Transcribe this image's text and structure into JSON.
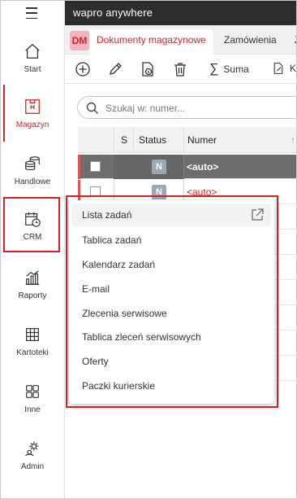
{
  "app": {
    "brand": "wapro anywhere"
  },
  "sidebar": {
    "items": [
      {
        "label": "Start",
        "icon": "home-icon"
      },
      {
        "label": "Magazyn",
        "icon": "warehouse-icon"
      },
      {
        "label": "Handlowe",
        "icon": "coins-icon"
      },
      {
        "label": "CRM",
        "icon": "calendar-clock-icon"
      },
      {
        "label": "Raporty",
        "icon": "chart-icon"
      },
      {
        "label": "Kartoteki",
        "icon": "grid-icon"
      },
      {
        "label": "Inne",
        "icon": "apps-icon"
      },
      {
        "label": "Admin",
        "icon": "admin-gear-icon"
      }
    ],
    "active": "Magazyn"
  },
  "tabs": {
    "badge": "DM",
    "active": "Dokumenty magazynowe",
    "second": "Zamówienia",
    "third": "Z"
  },
  "toolbar": {
    "suma_label": "Suma",
    "k_label": "K"
  },
  "search": {
    "placeholder": "Szukaj w: numer..."
  },
  "grid": {
    "headers": {
      "s": "S",
      "status": "Status",
      "numer": "Numer",
      "sort": "↑"
    },
    "rows": [
      {
        "status": "N",
        "numer": "<auto>"
      },
      {
        "status": "N",
        "numer": "<auto>"
      }
    ]
  },
  "crm_menu": {
    "items": [
      "Lista zadań",
      "Tablica zadań",
      "Kalendarz zadań",
      "E-mail",
      "Zlecenia serwisowe",
      "Tablica zleceń serwisowych",
      "Oferty",
      "Paczki kurierskie"
    ]
  },
  "colors": {
    "accent": "#c62828",
    "highlight": "#d32027",
    "topbar": "#2d2d2d"
  }
}
